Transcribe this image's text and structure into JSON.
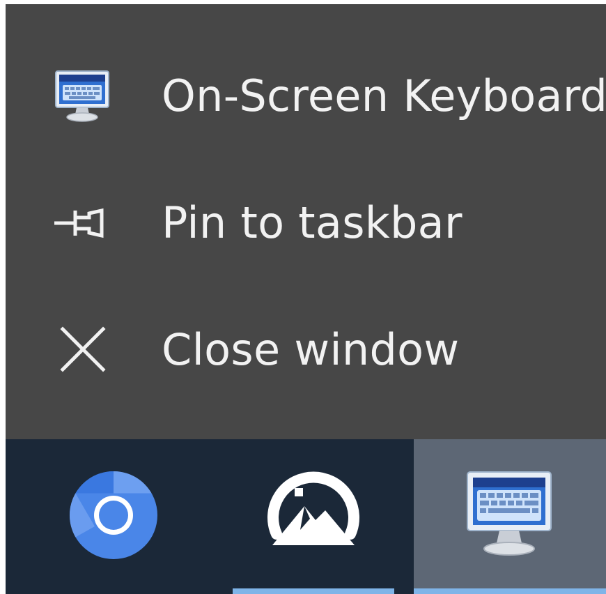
{
  "jump_list": {
    "items": [
      {
        "label": "On-Screen Keyboard",
        "icon": "on-screen-keyboard-icon"
      },
      {
        "label": "Pin to taskbar",
        "icon": "pin-icon"
      },
      {
        "label": "Close window",
        "icon": "close-icon"
      }
    ],
    "background": "#474747",
    "text_color": "#f2f2f2"
  },
  "taskbar": {
    "background": "#1b2838",
    "active_button_background": "#5d6775",
    "running_indicator_color": "#7fb4e8",
    "buttons": [
      {
        "icon": "chromium-icon",
        "running": false,
        "active": false
      },
      {
        "icon": "photos-app-icon",
        "running": true,
        "active": false
      },
      {
        "icon": "on-screen-keyboard-icon",
        "running": true,
        "active": true
      }
    ]
  }
}
